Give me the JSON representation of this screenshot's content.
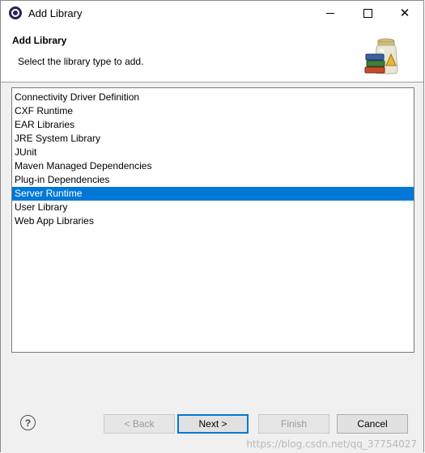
{
  "window": {
    "title": "Add Library",
    "controls": {
      "minimize": "—",
      "maximize": "□",
      "close": "✕"
    }
  },
  "header": {
    "title": "Add Library",
    "subtitle": "Select the library type to add."
  },
  "library_types": [
    {
      "label": "Connectivity Driver Definition",
      "selected": false
    },
    {
      "label": "CXF Runtime",
      "selected": false
    },
    {
      "label": "EAR Libraries",
      "selected": false
    },
    {
      "label": "JRE System Library",
      "selected": false
    },
    {
      "label": "JUnit",
      "selected": false
    },
    {
      "label": "Maven Managed Dependencies",
      "selected": false
    },
    {
      "label": "Plug-in Dependencies",
      "selected": false
    },
    {
      "label": "Server Runtime",
      "selected": true
    },
    {
      "label": "User Library",
      "selected": false
    },
    {
      "label": "Web App Libraries",
      "selected": false
    }
  ],
  "footer": {
    "help_icon": "?",
    "back_label": "< Back",
    "next_label": "Next >",
    "finish_label": "Finish",
    "cancel_label": "Cancel"
  },
  "watermark": "https://blog.csdn.net/qq_37754027",
  "colors": {
    "selection": "#0078d7",
    "default_button_border": "#0078d7"
  }
}
